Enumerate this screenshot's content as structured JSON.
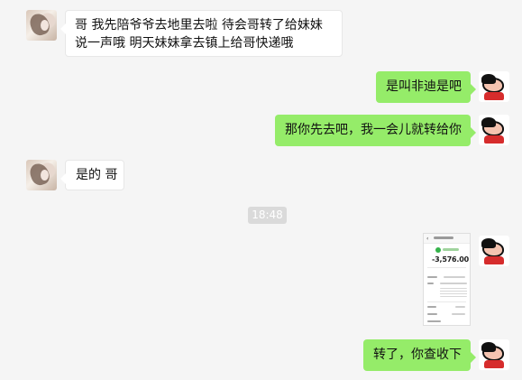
{
  "conversation": {
    "messages": [
      {
        "side": "left",
        "text": "哥 我先陪爷爷去地里去啦 待会哥转了给妹妹说一声哦 明天妹妹拿去镇上给哥快递哦"
      },
      {
        "side": "right",
        "text": "是叫非迪是吧"
      },
      {
        "side": "right",
        "text": "那你先去吧，我一会儿就转给你"
      },
      {
        "side": "left",
        "text": "是的 哥"
      },
      {
        "side": "right",
        "text": "转了，你查收下"
      }
    ],
    "timestamp": "18:48"
  },
  "payment_screenshot": {
    "back_icon": "chevron-left-icon",
    "amount": "-3,576.00",
    "status_color": "#34b34a"
  },
  "colors": {
    "background": "#f5f5f5",
    "left_bubble": "#ffffff",
    "right_bubble": "#95ec69",
    "timestamp_bg": "#dadada"
  }
}
